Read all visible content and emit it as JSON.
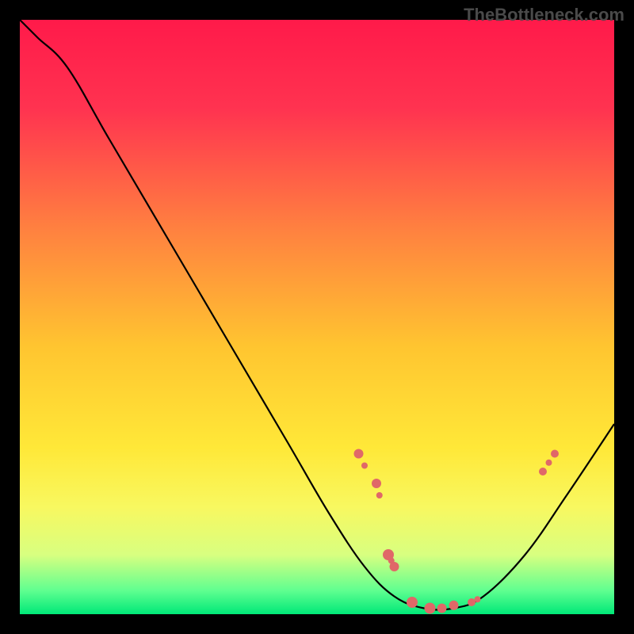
{
  "watermark": "TheBottleneck.com",
  "chart_data": {
    "type": "line",
    "title": "",
    "xlabel": "",
    "ylabel": "",
    "xlim": [
      0,
      100
    ],
    "ylim": [
      0,
      100
    ],
    "curve": {
      "name": "bottleneck-curve",
      "points": [
        {
          "x": 0,
          "y": 100
        },
        {
          "x": 3,
          "y": 97
        },
        {
          "x": 8,
          "y": 92
        },
        {
          "x": 15,
          "y": 80
        },
        {
          "x": 25,
          "y": 63
        },
        {
          "x": 35,
          "y": 46
        },
        {
          "x": 45,
          "y": 29
        },
        {
          "x": 52,
          "y": 17
        },
        {
          "x": 58,
          "y": 8
        },
        {
          "x": 63,
          "y": 3
        },
        {
          "x": 68,
          "y": 1
        },
        {
          "x": 73,
          "y": 1
        },
        {
          "x": 78,
          "y": 3
        },
        {
          "x": 85,
          "y": 10
        },
        {
          "x": 92,
          "y": 20
        },
        {
          "x": 100,
          "y": 32
        }
      ]
    },
    "markers": [
      {
        "x": 57,
        "y": 27,
        "size": 6
      },
      {
        "x": 58,
        "y": 25,
        "size": 4
      },
      {
        "x": 60,
        "y": 22,
        "size": 6
      },
      {
        "x": 60.5,
        "y": 20,
        "size": 4
      },
      {
        "x": 62,
        "y": 10,
        "size": 7
      },
      {
        "x": 62.5,
        "y": 9,
        "size": 4
      },
      {
        "x": 63,
        "y": 8,
        "size": 6
      },
      {
        "x": 66,
        "y": 2,
        "size": 7
      },
      {
        "x": 69,
        "y": 1,
        "size": 7
      },
      {
        "x": 71,
        "y": 1,
        "size": 6
      },
      {
        "x": 73,
        "y": 1.5,
        "size": 6
      },
      {
        "x": 76,
        "y": 2,
        "size": 5
      },
      {
        "x": 77,
        "y": 2.5,
        "size": 4
      },
      {
        "x": 88,
        "y": 24,
        "size": 5
      },
      {
        "x": 89,
        "y": 25.5,
        "size": 4
      },
      {
        "x": 90,
        "y": 27,
        "size": 5
      }
    ],
    "gradient_stops": [
      {
        "offset": 0,
        "color": "#ff1a4a"
      },
      {
        "offset": 0.15,
        "color": "#ff3350"
      },
      {
        "offset": 0.35,
        "color": "#ff8040"
      },
      {
        "offset": 0.55,
        "color": "#ffc530"
      },
      {
        "offset": 0.72,
        "color": "#ffe838"
      },
      {
        "offset": 0.82,
        "color": "#f8f860"
      },
      {
        "offset": 0.9,
        "color": "#d8ff80"
      },
      {
        "offset": 0.96,
        "color": "#60ff90"
      },
      {
        "offset": 1.0,
        "color": "#00e878"
      }
    ],
    "marker_color": "#e06868",
    "curve_color": "#000000"
  }
}
